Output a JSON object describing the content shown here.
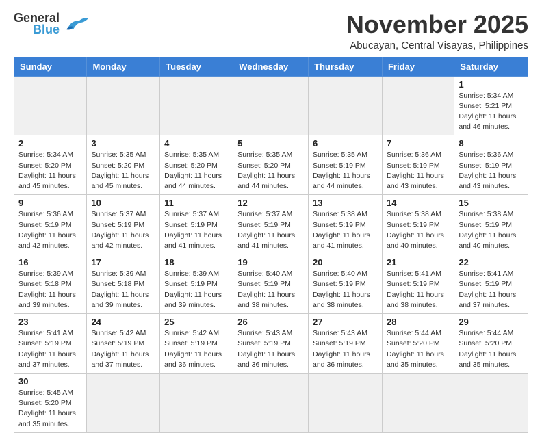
{
  "logo": {
    "line1": "General",
    "line2": "Blue"
  },
  "title": {
    "month": "November 2025",
    "location": "Abucayan, Central Visayas, Philippines"
  },
  "weekdays": [
    "Sunday",
    "Monday",
    "Tuesday",
    "Wednesday",
    "Thursday",
    "Friday",
    "Saturday"
  ],
  "days": [
    {
      "date": "",
      "info": ""
    },
    {
      "date": "",
      "info": ""
    },
    {
      "date": "",
      "info": ""
    },
    {
      "date": "",
      "info": ""
    },
    {
      "date": "",
      "info": ""
    },
    {
      "date": "",
      "info": ""
    },
    {
      "date": "1",
      "info": "Sunrise: 5:34 AM\nSunset: 5:21 PM\nDaylight: 11 hours and 46 minutes."
    },
    {
      "date": "2",
      "info": "Sunrise: 5:34 AM\nSunset: 5:20 PM\nDaylight: 11 hours and 45 minutes."
    },
    {
      "date": "3",
      "info": "Sunrise: 5:35 AM\nSunset: 5:20 PM\nDaylight: 11 hours and 45 minutes."
    },
    {
      "date": "4",
      "info": "Sunrise: 5:35 AM\nSunset: 5:20 PM\nDaylight: 11 hours and 44 minutes."
    },
    {
      "date": "5",
      "info": "Sunrise: 5:35 AM\nSunset: 5:20 PM\nDaylight: 11 hours and 44 minutes."
    },
    {
      "date": "6",
      "info": "Sunrise: 5:35 AM\nSunset: 5:19 PM\nDaylight: 11 hours and 44 minutes."
    },
    {
      "date": "7",
      "info": "Sunrise: 5:36 AM\nSunset: 5:19 PM\nDaylight: 11 hours and 43 minutes."
    },
    {
      "date": "8",
      "info": "Sunrise: 5:36 AM\nSunset: 5:19 PM\nDaylight: 11 hours and 43 minutes."
    },
    {
      "date": "9",
      "info": "Sunrise: 5:36 AM\nSunset: 5:19 PM\nDaylight: 11 hours and 42 minutes."
    },
    {
      "date": "10",
      "info": "Sunrise: 5:37 AM\nSunset: 5:19 PM\nDaylight: 11 hours and 42 minutes."
    },
    {
      "date": "11",
      "info": "Sunrise: 5:37 AM\nSunset: 5:19 PM\nDaylight: 11 hours and 41 minutes."
    },
    {
      "date": "12",
      "info": "Sunrise: 5:37 AM\nSunset: 5:19 PM\nDaylight: 11 hours and 41 minutes."
    },
    {
      "date": "13",
      "info": "Sunrise: 5:38 AM\nSunset: 5:19 PM\nDaylight: 11 hours and 41 minutes."
    },
    {
      "date": "14",
      "info": "Sunrise: 5:38 AM\nSunset: 5:19 PM\nDaylight: 11 hours and 40 minutes."
    },
    {
      "date": "15",
      "info": "Sunrise: 5:38 AM\nSunset: 5:19 PM\nDaylight: 11 hours and 40 minutes."
    },
    {
      "date": "16",
      "info": "Sunrise: 5:39 AM\nSunset: 5:18 PM\nDaylight: 11 hours and 39 minutes."
    },
    {
      "date": "17",
      "info": "Sunrise: 5:39 AM\nSunset: 5:18 PM\nDaylight: 11 hours and 39 minutes."
    },
    {
      "date": "18",
      "info": "Sunrise: 5:39 AM\nSunset: 5:19 PM\nDaylight: 11 hours and 39 minutes."
    },
    {
      "date": "19",
      "info": "Sunrise: 5:40 AM\nSunset: 5:19 PM\nDaylight: 11 hours and 38 minutes."
    },
    {
      "date": "20",
      "info": "Sunrise: 5:40 AM\nSunset: 5:19 PM\nDaylight: 11 hours and 38 minutes."
    },
    {
      "date": "21",
      "info": "Sunrise: 5:41 AM\nSunset: 5:19 PM\nDaylight: 11 hours and 38 minutes."
    },
    {
      "date": "22",
      "info": "Sunrise: 5:41 AM\nSunset: 5:19 PM\nDaylight: 11 hours and 37 minutes."
    },
    {
      "date": "23",
      "info": "Sunrise: 5:41 AM\nSunset: 5:19 PM\nDaylight: 11 hours and 37 minutes."
    },
    {
      "date": "24",
      "info": "Sunrise: 5:42 AM\nSunset: 5:19 PM\nDaylight: 11 hours and 37 minutes."
    },
    {
      "date": "25",
      "info": "Sunrise: 5:42 AM\nSunset: 5:19 PM\nDaylight: 11 hours and 36 minutes."
    },
    {
      "date": "26",
      "info": "Sunrise: 5:43 AM\nSunset: 5:19 PM\nDaylight: 11 hours and 36 minutes."
    },
    {
      "date": "27",
      "info": "Sunrise: 5:43 AM\nSunset: 5:19 PM\nDaylight: 11 hours and 36 minutes."
    },
    {
      "date": "28",
      "info": "Sunrise: 5:44 AM\nSunset: 5:20 PM\nDaylight: 11 hours and 35 minutes."
    },
    {
      "date": "29",
      "info": "Sunrise: 5:44 AM\nSunset: 5:20 PM\nDaylight: 11 hours and 35 minutes."
    },
    {
      "date": "30",
      "info": "Sunrise: 5:45 AM\nSunset: 5:20 PM\nDaylight: 11 hours and 35 minutes."
    },
    {
      "date": "",
      "info": ""
    },
    {
      "date": "",
      "info": ""
    },
    {
      "date": "",
      "info": ""
    },
    {
      "date": "",
      "info": ""
    },
    {
      "date": "",
      "info": ""
    },
    {
      "date": "",
      "info": ""
    }
  ]
}
